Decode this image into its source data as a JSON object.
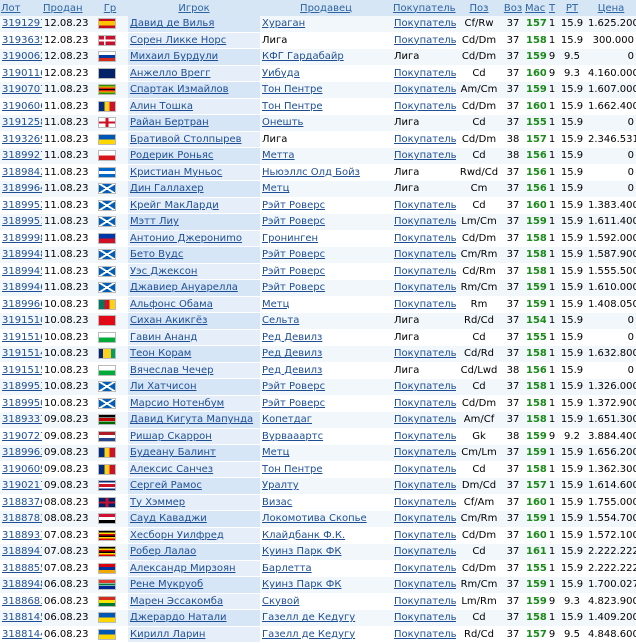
{
  "headers": {
    "lot": "Лот",
    "sold": "Продан",
    "country": "Гр",
    "player": "Игрок",
    "seller": "Продавец",
    "buyer": "Покупатель",
    "pos": "Поз",
    "age": "Воз",
    "mas": "Мас",
    "t": "Т",
    "rt": "РТ",
    "price": "Цена"
  },
  "rows": [
    {
      "lot": "3191297",
      "sold": "12.08.23",
      "flag": "spain",
      "player": "Давид де Вилья",
      "seller": "Хураган",
      "seller_link": true,
      "buyer": "Покупатель",
      "pos": "Cf/Rw",
      "age": "37",
      "mas": "157",
      "t": "1",
      "rt": "15.9",
      "price": "1.625.200"
    },
    {
      "lot": "3193635",
      "sold": "12.08.23",
      "flag": "denmark",
      "player": "Сорен Ликке Норс",
      "seller": "Лига",
      "seller_link": false,
      "buyer": "Покупатель",
      "pos": "Cd/Dm",
      "age": "37",
      "mas": "158",
      "t": "1",
      "rt": "15.9",
      "price": "300.000"
    },
    {
      "lot": "3190062",
      "sold": "12.08.23",
      "flag": "russia",
      "player": "Михаил Бурдули",
      "seller": "КФГ Гардабайр",
      "seller_link": true,
      "buyer": "Лига",
      "pos": "Cd/Dm",
      "age": "37",
      "mas": "159",
      "t": "9",
      "rt": "9.5",
      "price": "0"
    },
    {
      "lot": "3190116",
      "sold": "12.08.23",
      "flag": "australia",
      "player": "Анжелло Врегг",
      "seller": "Уибуда",
      "seller_link": true,
      "buyer": "Покупатель",
      "pos": "Cd",
      "age": "37",
      "mas": "160",
      "t": "9",
      "rt": "9.3",
      "price": "4.160.000"
    },
    {
      "lot": "3190707",
      "sold": "11.08.23",
      "flag": "zimbabwe",
      "player": "Спартак Измайлов",
      "seller": "Тон Пентре",
      "seller_link": true,
      "buyer": "Покупатель",
      "pos": "Am/Cm",
      "age": "37",
      "mas": "159",
      "t": "1",
      "rt": "15.9",
      "price": "1.607.000"
    },
    {
      "lot": "3190606",
      "sold": "11.08.23",
      "flag": "romania",
      "player": "Алин Тошка",
      "seller": "Тон Пентре",
      "seller_link": true,
      "buyer": "Покупатель",
      "pos": "Cd/Dm",
      "age": "37",
      "mas": "160",
      "t": "1",
      "rt": "15.9",
      "price": "1.662.400"
    },
    {
      "lot": "3191258",
      "sold": "11.08.23",
      "flag": "england",
      "player": "Райан Бертран",
      "seller": "Онешть",
      "seller_link": true,
      "buyer": "Лига",
      "pos": "Cd",
      "age": "37",
      "mas": "155",
      "t": "1",
      "rt": "15.9",
      "price": "0"
    },
    {
      "lot": "3193269",
      "sold": "11.08.23",
      "flag": "ukraine",
      "player": "Бративой Столпырев",
      "seller": "Лига",
      "seller_link": false,
      "buyer": "Покупатель",
      "pos": "Cd/Dm",
      "age": "38",
      "mas": "157",
      "t": "1",
      "rt": "15.9",
      "price": "2.346.531"
    },
    {
      "lot": "3189927",
      "sold": "11.08.23",
      "flag": "czech",
      "player": "Родерик Роньяс",
      "seller": "Метта",
      "seller_link": true,
      "buyer": "Покупатель",
      "pos": "Cd",
      "age": "38",
      "mas": "156",
      "t": "1",
      "rt": "15.9",
      "price": "0"
    },
    {
      "lot": "3189842",
      "sold": "11.08.23",
      "flag": "nicaragua",
      "player": "Кристиан Муньос",
      "seller": "Ньюэллс Олд Бойз",
      "seller_link": true,
      "buyer": "Лига",
      "pos": "Rwd/Cd",
      "age": "37",
      "mas": "156",
      "t": "1",
      "rt": "15.9",
      "price": "0"
    },
    {
      "lot": "3189964",
      "sold": "11.08.23",
      "flag": "scotland",
      "player": "Дин Галлахер",
      "seller": "Метц",
      "seller_link": true,
      "buyer": "Лига",
      "pos": "Cm",
      "age": "37",
      "mas": "156",
      "t": "1",
      "rt": "15.9",
      "price": "0"
    },
    {
      "lot": "3189952",
      "sold": "11.08.23",
      "flag": "scotland",
      "player": "Крейг МакЛарди",
      "seller": "Рэйт Роверс",
      "seller_link": true,
      "buyer": "Покупатель",
      "pos": "Cd",
      "age": "37",
      "mas": "160",
      "t": "1",
      "rt": "15.9",
      "price": "1.383.400"
    },
    {
      "lot": "3189951",
      "sold": "11.08.23",
      "flag": "scotland",
      "player": "Мэтт Лиу",
      "seller": "Рэйт Роверс",
      "seller_link": true,
      "buyer": "Покупатель",
      "pos": "Lm/Cm",
      "age": "37",
      "mas": "159",
      "t": "1",
      "rt": "15.9",
      "price": "1.611.400"
    },
    {
      "lot": "3189998",
      "sold": "11.08.23",
      "flag": "philippines",
      "player": "Антонио Джерониmo",
      "seller": "Гронинген",
      "seller_link": true,
      "buyer": "Покупатель",
      "pos": "Cd/Dm",
      "age": "37",
      "mas": "158",
      "t": "1",
      "rt": "15.9",
      "price": "1.592.000"
    },
    {
      "lot": "3189948",
      "sold": "11.08.23",
      "flag": "scotland",
      "player": "Бето Вудс",
      "seller": "Рэйт Роверс",
      "seller_link": true,
      "buyer": "Покупатель",
      "pos": "Cm/Rm",
      "age": "37",
      "mas": "158",
      "t": "1",
      "rt": "15.9",
      "price": "1.587.900"
    },
    {
      "lot": "3189945",
      "sold": "11.08.23",
      "flag": "scotland",
      "player": "Уэс Джексон",
      "seller": "Рэйт Роверс",
      "seller_link": true,
      "buyer": "Покупатель",
      "pos": "Cd/Rm",
      "age": "37",
      "mas": "158",
      "t": "1",
      "rt": "15.9",
      "price": "1.555.500"
    },
    {
      "lot": "3189946",
      "sold": "11.08.23",
      "flag": "scotland",
      "player": "Джавиер Ануарелла",
      "seller": "Рэйт Роверс",
      "seller_link": true,
      "buyer": "Покупатель",
      "pos": "Rm/Cm",
      "age": "37",
      "mas": "159",
      "t": "1",
      "rt": "15.9",
      "price": "1.610.000"
    },
    {
      "lot": "3189966",
      "sold": "10.08.23",
      "flag": "cameroon",
      "player": "Альфонс Обама",
      "seller": "Метц",
      "seller_link": true,
      "buyer": "Покупатель",
      "pos": "Rm",
      "age": "37",
      "mas": "159",
      "t": "1",
      "rt": "15.9",
      "price": "1.408.050"
    },
    {
      "lot": "3191510",
      "sold": "10.08.23",
      "flag": "turkey",
      "player": "Сихан Акикгёз",
      "seller": "Сельта",
      "seller_link": true,
      "buyer": "Лига",
      "pos": "Rd/Cd",
      "age": "37",
      "mas": "154",
      "t": "1",
      "rt": "15.9",
      "price": "0"
    },
    {
      "lot": "3191516",
      "sold": "10.08.23",
      "flag": "wales",
      "player": "Гавин Ананд",
      "seller": "Ред Девилз",
      "seller_link": true,
      "buyer": "Лига",
      "pos": "Cd",
      "age": "37",
      "mas": "155",
      "t": "1",
      "rt": "15.9",
      "price": "0"
    },
    {
      "lot": "3191514",
      "sold": "10.08.23",
      "flag": "stvincent",
      "player": "Теон Корам",
      "seller": "Ред Девилз",
      "seller_link": true,
      "buyer": "Покупатель",
      "pos": "Cd/Rd",
      "age": "37",
      "mas": "158",
      "t": "1",
      "rt": "15.9",
      "price": "1.632.800"
    },
    {
      "lot": "3191515",
      "sold": "10.08.23",
      "flag": "wales",
      "player": "Вячеслав Чечер",
      "seller": "Ред Девилз",
      "seller_link": true,
      "buyer": "Лига",
      "pos": "Cd/Lwd",
      "age": "38",
      "mas": "156",
      "t": "1",
      "rt": "15.9",
      "price": "0"
    },
    {
      "lot": "3189953",
      "sold": "10.08.23",
      "flag": "scotland",
      "player": "Ли Хатчисон",
      "seller": "Рэйт Роверс",
      "seller_link": true,
      "buyer": "Покупатель",
      "pos": "Cd",
      "age": "37",
      "mas": "158",
      "t": "1",
      "rt": "15.9",
      "price": "1.326.000"
    },
    {
      "lot": "3189950",
      "sold": "10.08.23",
      "flag": "scotland",
      "player": "Марсио Нотенбум",
      "seller": "Рэйт Роверс",
      "seller_link": true,
      "buyer": "Покупатель",
      "pos": "Cd/Dm",
      "age": "37",
      "mas": "158",
      "t": "1",
      "rt": "15.9",
      "price": "1.372.900"
    },
    {
      "lot": "3189337",
      "sold": "09.08.23",
      "flag": "kenya",
      "player": "Давид Кигута Мапунда",
      "seller": "Копетдаг",
      "seller_link": true,
      "buyer": "Покупатель",
      "pos": "Am/Cf",
      "age": "37",
      "mas": "158",
      "t": "1",
      "rt": "15.9",
      "price": "1.651.300"
    },
    {
      "lot": "3190727",
      "sold": "09.08.23",
      "flag": "netherlands",
      "player": "Ришар Скаррон",
      "seller": "Вурвааартс",
      "seller_link": true,
      "buyer": "Покупатель",
      "pos": "Gk",
      "age": "38",
      "mas": "159",
      "t": "9",
      "rt": "9.2",
      "price": "3.884.400"
    },
    {
      "lot": "3189963",
      "sold": "09.08.23",
      "flag": "romania",
      "player": "Будеану Балинт",
      "seller": "Метц",
      "seller_link": true,
      "buyer": "Покупатель",
      "pos": "Cm/Lm",
      "age": "37",
      "mas": "159",
      "t": "1",
      "rt": "15.9",
      "price": "1.656.200"
    },
    {
      "lot": "3190609",
      "sold": "09.08.23",
      "flag": "romania",
      "player": "Алексис Санчез",
      "seller": "Тон Пентре",
      "seller_link": true,
      "buyer": "Покупатель",
      "pos": "Cd",
      "age": "37",
      "mas": "158",
      "t": "1",
      "rt": "15.9",
      "price": "1.362.300"
    },
    {
      "lot": "3190217",
      "sold": "09.08.23",
      "flag": "costarica",
      "player": "Сергей Рамос",
      "seller": "Уралту",
      "seller_link": true,
      "buyer": "Покупатель",
      "pos": "Dm/Cd",
      "age": "37",
      "mas": "157",
      "t": "1",
      "rt": "15.9",
      "price": "1.614.600"
    },
    {
      "lot": "3188376",
      "sold": "08.08.23",
      "flag": "uk",
      "player": "Ту Хэммер",
      "seller": "Визас",
      "seller_link": true,
      "buyer": "Покупатель",
      "pos": "Cf/Am",
      "age": "37",
      "mas": "160",
      "t": "1",
      "rt": "15.9",
      "price": "1.755.000"
    },
    {
      "lot": "3188781",
      "sold": "08.08.23",
      "flag": "sudan",
      "player": "Сауд Каваджи",
      "seller": "Локомотива Скопье",
      "seller_link": true,
      "buyer": "Покупатель",
      "pos": "Cm/Rm",
      "age": "37",
      "mas": "159",
      "t": "1",
      "rt": "15.9",
      "price": "1.554.700"
    },
    {
      "lot": "3188931",
      "sold": "07.08.23",
      "flag": "uganda",
      "player": "Хесборн Уилфред",
      "seller": "Клайдбанк Ф.К.",
      "seller_link": true,
      "buyer": "Покупатель",
      "pos": "Cd/Dm",
      "age": "37",
      "mas": "160",
      "t": "1",
      "rt": "15.9",
      "price": "1.572.100"
    },
    {
      "lot": "3188947",
      "sold": "07.08.23",
      "flag": "uganda",
      "player": "Робер Лалао",
      "seller": "Куинз Парк ФК",
      "seller_link": true,
      "buyer": "Покупатель",
      "pos": "Cd",
      "age": "37",
      "mas": "161",
      "t": "1",
      "rt": "15.9",
      "price": "2.222.222"
    },
    {
      "lot": "3188855",
      "sold": "07.08.23",
      "flag": "armenia",
      "player": "Александр Мирзоян",
      "seller": "Барлетта",
      "seller_link": true,
      "buyer": "Покупатель",
      "pos": "Cd/Dm",
      "age": "37",
      "mas": "155",
      "t": "1",
      "rt": "15.9",
      "price": "2.222.222"
    },
    {
      "lot": "3188948",
      "sold": "06.08.23",
      "flag": "southafrica",
      "player": "Рене Мукруоб",
      "seller": "Куинз Парк ФК",
      "seller_link": true,
      "buyer": "Покупатель",
      "pos": "Rm/Cm",
      "age": "37",
      "mas": "159",
      "t": "1",
      "rt": "15.9",
      "price": "1.700.027"
    },
    {
      "lot": "3188683",
      "sold": "06.08.23",
      "flag": "bolivia",
      "player": "Марен Эссакомба",
      "seller": "Скувой",
      "seller_link": true,
      "buyer": "Покупатель",
      "pos": "Lm/Rm",
      "age": "37",
      "mas": "159",
      "t": "9",
      "rt": "9.3",
      "price": "4.823.900"
    },
    {
      "lot": "3188145",
      "sold": "06.08.23",
      "flag": "ukraine",
      "player": "Джерардо Натали",
      "seller": "Газелл де Кедугу",
      "seller_link": true,
      "buyer": "Покупатель",
      "pos": "Cd",
      "age": "37",
      "mas": "158",
      "t": "1",
      "rt": "15.9",
      "price": "1.409.200"
    },
    {
      "lot": "3188144",
      "sold": "06.08.23",
      "flag": "ukraine",
      "player": "Кирилл Ларин",
      "seller": "Газелл де Кедугу",
      "seller_link": true,
      "buyer": "Покупатель",
      "pos": "Rd/Cd",
      "age": "37",
      "mas": "157",
      "t": "9",
      "rt": "9.5",
      "price": "4.848.600"
    }
  ]
}
